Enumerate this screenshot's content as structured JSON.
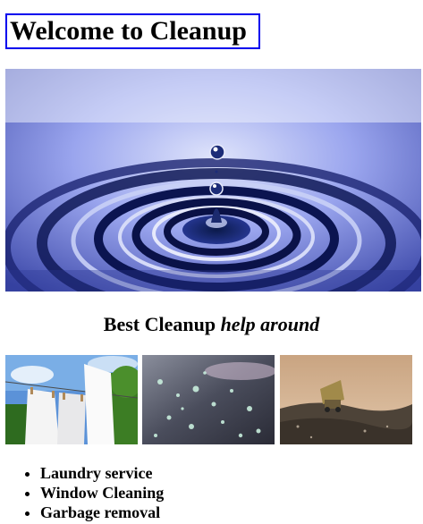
{
  "page": {
    "title": "Welcome to Cleanup",
    "hero_image": "water-drop-ripples",
    "tagline": {
      "main": "Best Cleanup",
      "emphasis": "help around"
    },
    "thumbnails": [
      {
        "name": "laundry-clothesline"
      },
      {
        "name": "water-droplets-window"
      },
      {
        "name": "garbage-truck-landfill"
      }
    ],
    "services": [
      "Laundry service",
      "Window Cleaning",
      "Garbage removal"
    ]
  },
  "colors": {
    "title_border": "#0000ee",
    "text": "#000000",
    "background": "#ffffff"
  }
}
